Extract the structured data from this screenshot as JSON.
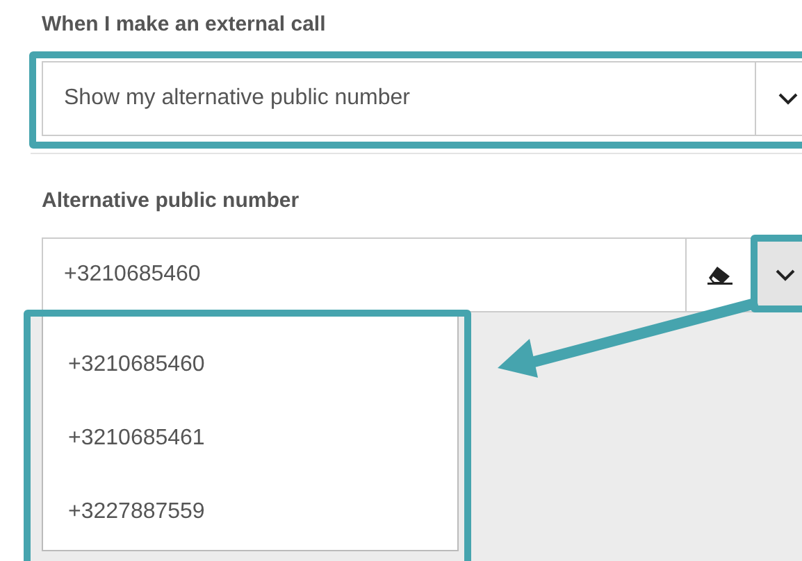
{
  "call_setting": {
    "label": "When I make an external call",
    "value": "Show my alternative public number"
  },
  "alternative_number": {
    "label": "Alternative public number",
    "value": "+3210685460",
    "expanded": true,
    "options": [
      {
        "label": "+3210685460"
      },
      {
        "label": "+3210685461"
      },
      {
        "label": "+3227887559"
      }
    ]
  }
}
